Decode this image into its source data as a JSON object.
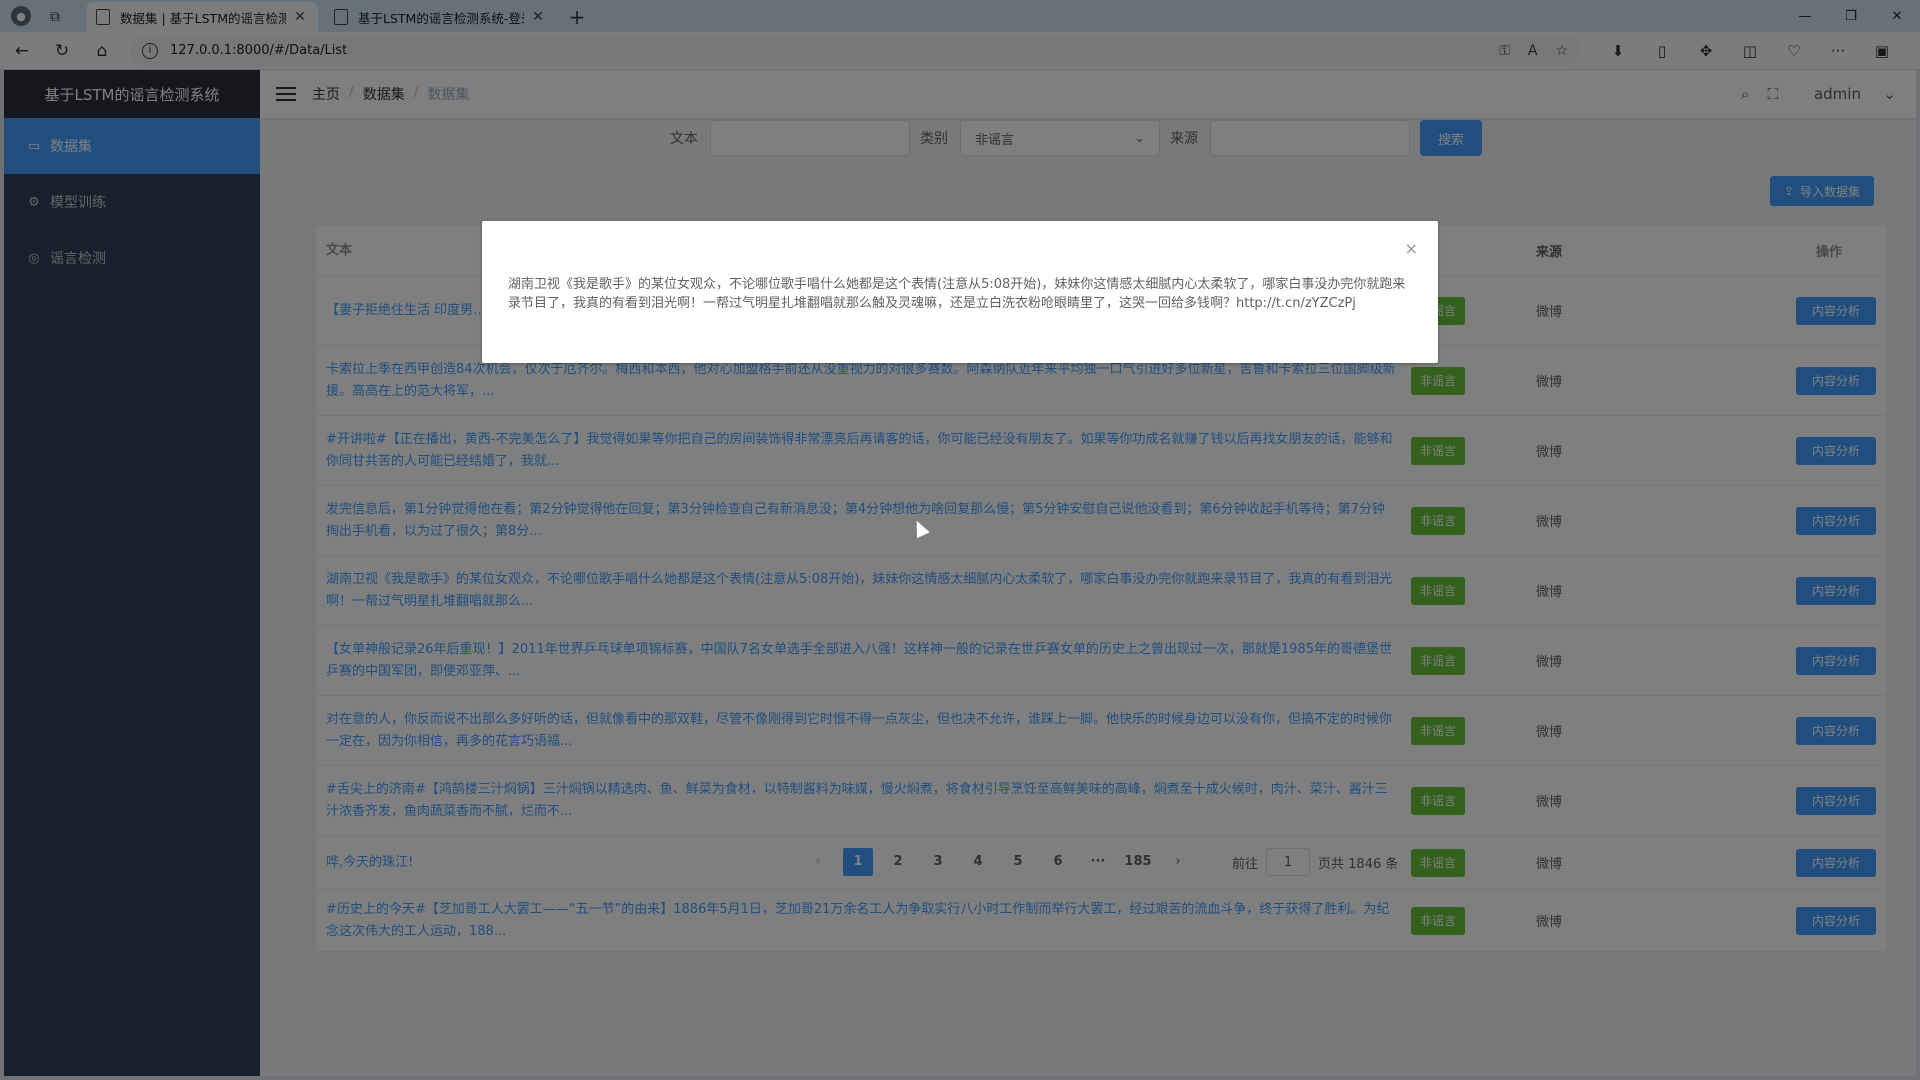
{
  "browser": {
    "tabs": [
      {
        "title": "数据集 | 基于LSTM的谣言检测系",
        "active": true
      },
      {
        "title": "基于LSTM的谣言检测系统-登录",
        "active": false
      }
    ],
    "url": "127.0.0.1:8000/#/Data/List",
    "icons": [
      "back-icon",
      "refresh-icon",
      "home-icon",
      "info-icon",
      "read-aloud-icon",
      "text-size-icon",
      "favorite-icon",
      "collections-icon",
      "split-icon",
      "extensions-icon",
      "sidebar-icon",
      "more-icon"
    ]
  },
  "app": {
    "logo": "基于LSTM的谣言检测系统",
    "menu": [
      {
        "label": "数据集",
        "icon": "monitor-icon",
        "active": true
      },
      {
        "label": "模型训练",
        "icon": "gear-icon",
        "active": false
      },
      {
        "label": "谣言检测",
        "icon": "globe-icon",
        "active": false
      }
    ],
    "breadcrumb": [
      "主页",
      "数据集",
      "数据集"
    ],
    "user": "admin",
    "accent": "#409eff",
    "success": "#67c23a"
  },
  "search": {
    "text_label": "文本",
    "type_label": "类别",
    "type_value": "非谣言",
    "source_label": "来源",
    "search_button": "搜索",
    "import_button": "导入数据集"
  },
  "table": {
    "headers": {
      "text": "文本",
      "type": "类别",
      "source": "来源",
      "op": "操作"
    },
    "rows": [
      {
        "text": "【妻子拒绝住生活 印度男…工作的地方…50米的地方。回来后，他…",
        "type": "非谣言",
        "source": "微博",
        "op": "内容分析"
      },
      {
        "text": "卡索拉上季在西甲创造84次机会，仅次于厄齐尔。梅西和本西，他对心加盟格手前还从没重视力的对很多赛数。阿森纳队近年来平均独一口气引进好多位新星，吉鲁和卡索拉三位国脚级新援。高高在上的范大将军，...",
        "type": "非谣言",
        "source": "微博",
        "op": "内容分析"
      },
      {
        "text": "#开讲啦#【正在播出，黄西-不完美怎么了】我觉得如果等你把自己的房间装饰得非常漂亮后再请客的话，你可能已经没有朋友了。如果等你功成名就赚了钱以后再找女朋友的话，能够和你同甘共苦的人可能已经结婚了，我就...",
        "type": "非谣言",
        "source": "微博",
        "op": "内容分析"
      },
      {
        "text": "发完信息后，第1分钟觉得他在看；第2分钟觉得他在回复；第3分钟检查自己有新消息没；第4分钟想他为啥回复那么慢；第5分钟安慰自己说他没看到；第6分钟收起手机等待；第7分钟掏出手机看，以为过了很久；第8分...",
        "type": "非谣言",
        "source": "微博",
        "op": "内容分析"
      },
      {
        "text": "湖南卫视《我是歌手》的某位女观众，不论哪位歌手唱什么她都是这个表情(注意从5:08开始)，妹妹你这情感太细腻内心太柔软了，哪家白事没办完你就跑来录节目了，我真的有看到泪光啊！一帮过气明星扎堆翻唱就那么...",
        "type": "非谣言",
        "source": "微博",
        "op": "内容分析"
      },
      {
        "text": "【女单神般记录26年后重现！】2011年世界乒乓球单项锦标赛，中国队7名女单选手全部进入八强！这样神一般的记录在世乒赛女单的历史上之曾出现过一次，那就是1985年的哥德堡世乒赛的中国军团，即便邓亚萍、...",
        "type": "非谣言",
        "source": "微博",
        "op": "内容分析"
      },
      {
        "text": "对在意的人，你反而说不出那么多好听的话，但就像看中的那双鞋，尽管不像刚得到它时恨不得一点灰尘，但也决不允许，谁踩上一脚。他快乐的时候身边可以没有你，但搞不定的时候你一定在，因为你相信，再多的花言巧语福...",
        "type": "非谣言",
        "source": "微博",
        "op": "内容分析"
      },
      {
        "text": "#舌尖上的济南#【鸿鹄楼三汁焖锅】三汁焖锅以精选肉、鱼、鲜菜为食材，以特制酱料为味媒，慢火焖煮，将食材引导烹饪至高鲜美味的高峰，焖煮至十成火候时，肉汁、菜汁、酱汁三汁浓香齐发，鱼肉蔬菜香而不腻，烂而不...",
        "type": "非谣言",
        "source": "微博",
        "op": "内容分析"
      },
      {
        "text": "哗,今天的珠江!",
        "type": "非谣言",
        "source": "微博",
        "op": "内容分析"
      },
      {
        "text": "#历史上的今天#【芝加哥工人大罢工——“五一节”的由来】1886年5月1日，芝加哥21万余名工人为争取实行八小时工作制而举行大罢工，经过艰苦的流血斗争，终于获得了胜利。为纪念这次伟大的工人运动，188...",
        "type": "非谣言",
        "source": "微博",
        "op": "内容分析"
      }
    ]
  },
  "pagination": {
    "prev": "‹",
    "pages": [
      "1",
      "2",
      "3",
      "4",
      "5",
      "6",
      "···",
      "185"
    ],
    "next": "›",
    "goto_label": "前往",
    "goto_value": "1",
    "total": "页共 1846 条"
  },
  "dialog": {
    "body": "湖南卫视《我是歌手》的某位女观众，不论哪位歌手唱什么她都是这个表情(注意从5:08开始)，妹妹你这情感太细腻内心太柔软了，哪家白事没办完你就跑来录节目了，我真的有看到泪光啊！一帮过气明星扎堆翻唱就那么触及灵魂嘛，还是立白洗衣粉呛眼睛里了，这哭一回给多钱啊？http://t.cn/zYZCzPj",
    "close": "×"
  }
}
